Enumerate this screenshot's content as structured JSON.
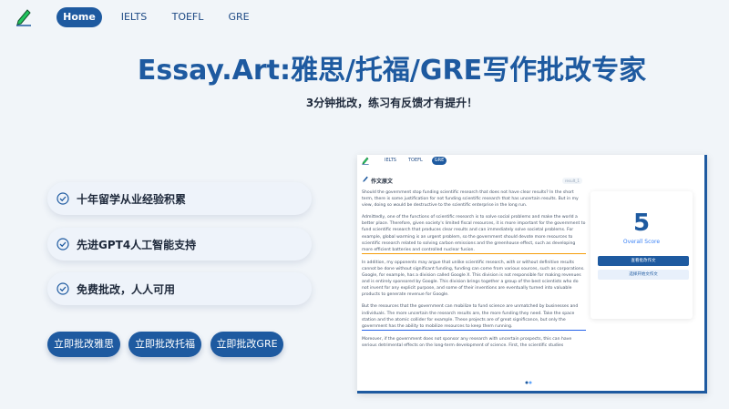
{
  "nav": {
    "home": "Home",
    "ielts": "IELTS",
    "toefl": "TOEFL",
    "gre": "GRE"
  },
  "hero": {
    "title": "Essay.Art:雅思/托福/GRE写作批改专家",
    "subtitle": "3分钟批改，练习有反馈才有提升！"
  },
  "features": [
    "十年留学从业经验积累",
    "先进GPT4人工智能支持",
    "免费批改，人人可用"
  ],
  "buttons": {
    "ielts": "立即批改雅思",
    "toefl": "立即批改托福",
    "gre": "立即批改GRE"
  },
  "preview": {
    "nav": {
      "ielts": "IELTS",
      "toefl": "TOEFL",
      "gre": "GRE"
    },
    "heading": "作文原文",
    "badge": "result_1",
    "paragraphs": [
      "Should the government stop funding scientific research that does not have clear results? In the short term, there is some justification for not funding scientific research that has uncertain results. But in my view, doing so would be destructive to the scientific enterprise in the long run.",
      "Admittedly, one of the functions of scientific research is to solve social problems and make the world a better place. Therefore, given society's limited fiscal resources, it is more important for the government to fund scientific research that produces clear results and can immediately solve societal problems. For example, global warming is an urgent problem, so the government should devote more resources to scientific research related to solving carbon emissions and the greenhouse effect, such as developing more efficient batteries and controlled nuclear fusion.",
      "In addition, my opponents may argue that unlike scientific research, with or without definitive results cannot be done without significant funding, funding can come from various sources, such as corporations. Google, for example, has a division called Google X. This division is not responsible for making revenues and is entirely sponsored by Google. This division brings together a group of the best scientists who do not invent for any explicit purpose, and some of their inventions are eventually turned into valuable products to generate revenue for Google.",
      "But the resources that the government can mobilize to fund science are unmatched by businesses and individuals. The more uncertain the research results are, the more funding they need. Take the space station and the atomic collider for example. These projects are of great significance, but only the government has the ability to mobilize resources to keep them running.",
      "Moreover, if the government does not sponsor any research with uncertain prospects, this can have serious detrimental effects on the long-term development of science. First, the scientific studies"
    ],
    "score": "5",
    "score_label": "Overall Score",
    "btn_view": "查看批改作文",
    "btn_download": "选择开始文作文"
  }
}
